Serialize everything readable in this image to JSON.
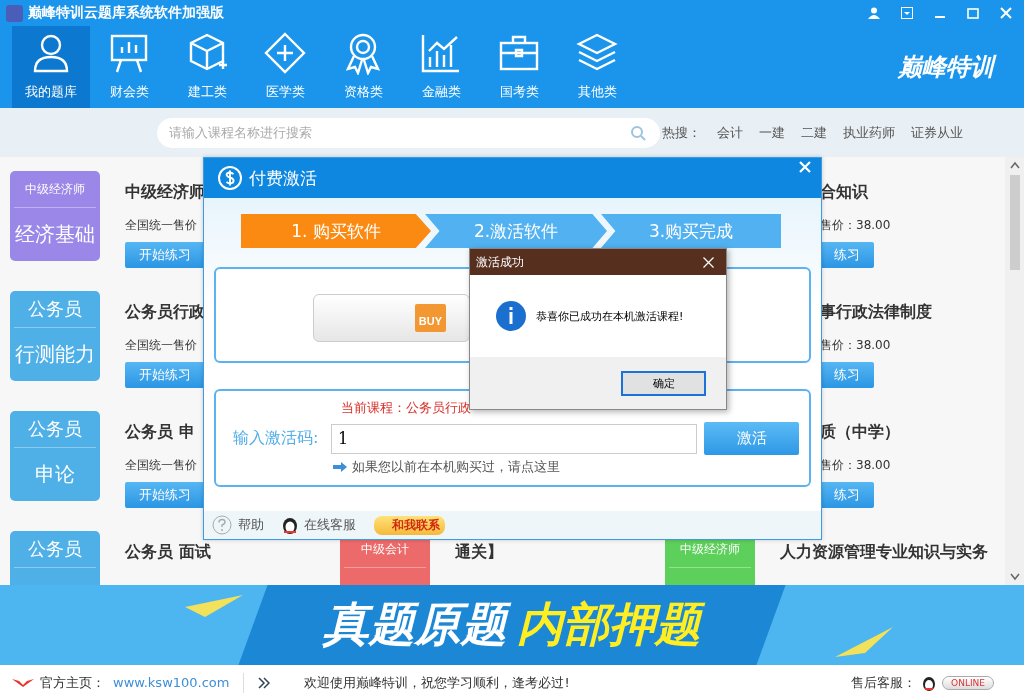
{
  "window": {
    "title": "巅峰特训云题库系统软件加强版"
  },
  "nav": [
    {
      "label": "我的题库",
      "selected": true
    },
    {
      "label": "财会类",
      "selected": false
    },
    {
      "label": "建工类",
      "selected": false
    },
    {
      "label": "医学类",
      "selected": false
    },
    {
      "label": "资格类",
      "selected": false
    },
    {
      "label": "金融类",
      "selected": false
    },
    {
      "label": "国考类",
      "selected": false
    },
    {
      "label": "其他类",
      "selected": false
    }
  ],
  "logo": "巅峰特训",
  "search": {
    "placeholder": "请输入课程名称进行搜索"
  },
  "hot": {
    "label": "热搜：",
    "links": [
      "会计",
      "一建",
      "二建",
      "执业药师",
      "证券从业"
    ]
  },
  "courses": [
    {
      "left": {
        "badge": {
          "top": "中级经济师",
          "main": "经济基础",
          "color": "#9b87e8"
        },
        "title": "中级经济师",
        "price": "全国统一售价",
        "button": "开始练习"
      },
      "right": {
        "title": "合知识",
        "price": "售价：38.00",
        "button": "练习"
      }
    },
    {
      "left": {
        "badge": {
          "top": "公务员",
          "main": "行测能力",
          "color": "#4fb0e8"
        },
        "title": "公务员行政",
        "price": "全国统一售价",
        "button": "开始练习"
      },
      "right": {
        "title": "事行政法律制度",
        "price": "售价：38.00",
        "button": "练习"
      }
    },
    {
      "left": {
        "badge": {
          "top": "公务员",
          "main": "申论",
          "color": "#4fb0e8"
        },
        "title": "公务员  申",
        "price": "全国统一售价",
        "button": "开始练习"
      },
      "right": {
        "title": "质（中学）",
        "price": "售价：38.00",
        "button": "练习"
      }
    },
    {
      "left": {
        "badge": {
          "top": "公务员",
          "color": "#4fb0e8"
        },
        "title": "公务员  面试"
      },
      "middle": {
        "badge": {
          "top": "中级会计",
          "color": "#ec6a6a"
        },
        "title": "通关】"
      },
      "right": {
        "badge": {
          "top": "中级经济师",
          "color": "#5dcf5b"
        },
        "title": "人力资源管理专业知识与实务"
      }
    }
  ],
  "activation_dialog": {
    "title": "付费激活",
    "steps": [
      {
        "label": "1. 购买软件",
        "selected": true
      },
      {
        "label": "2.激活软件",
        "selected": false
      },
      {
        "label": "3.购买完成",
        "selected": false
      }
    ],
    "buy_label": "BUY",
    "current_course": "当前课程：公务员行政",
    "code_label": "输入激活码:",
    "code_value": "1",
    "activate_button": "激活",
    "hint_link": "如果您以前在本机购买过，请点这里",
    "footer": {
      "help": "帮助",
      "service": "在线客服",
      "contact": "和我联系"
    }
  },
  "message_box": {
    "title": "激活成功",
    "message": "恭喜你已成功在本机激活课程!",
    "ok": "确定"
  },
  "banner": {
    "white": "真题原题",
    "yellow": "内部押题"
  },
  "footer": {
    "home_label": "官方主页：",
    "home_link": "www.ksw100.com",
    "welcome": "欢迎使用巅峰特训，祝您学习顺利，逢考必过!",
    "support_label": "售后客服：",
    "online": "ONLINE"
  }
}
